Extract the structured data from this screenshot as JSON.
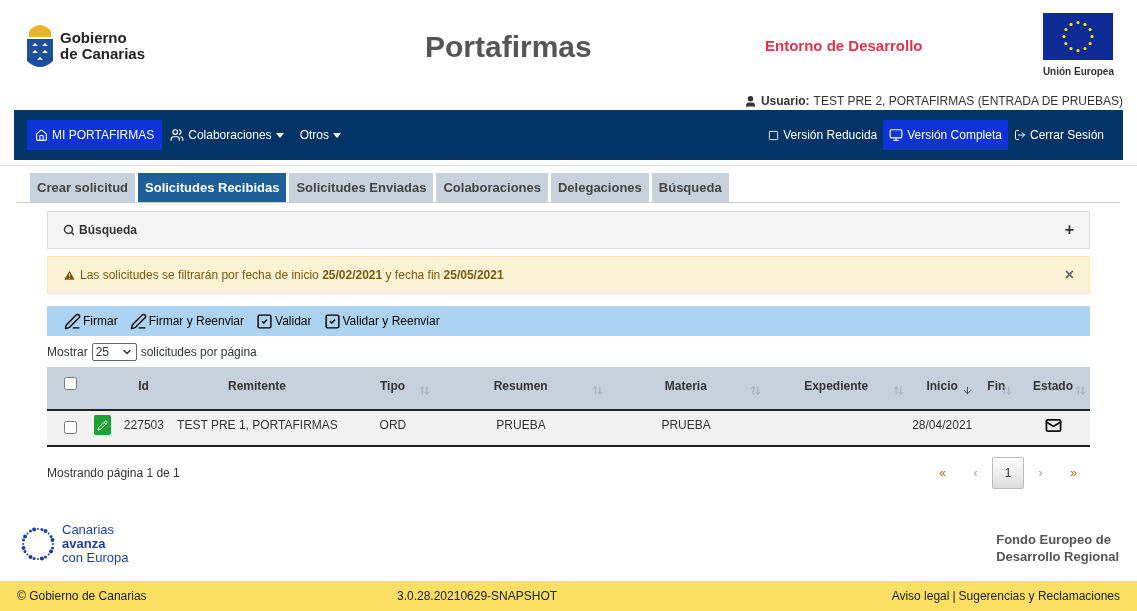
{
  "header": {
    "logo_lines": [
      "Gobierno",
      "de Canarias"
    ],
    "title": "Portafirmas",
    "environment": "Entorno de Desarrollo",
    "eu_label": "Unión Europea",
    "user_label": "Usuario:",
    "user_name": "TEST PRE 2, PORTAFIRMAS (ENTRADA DE PRUEBAS)"
  },
  "nav": {
    "left": [
      {
        "label": "MI PORTAFIRMAS",
        "selected": true,
        "dropdown": false
      },
      {
        "label": "Colaboraciones",
        "selected": false,
        "dropdown": true
      },
      {
        "label": "Otros",
        "selected": false,
        "dropdown": true
      }
    ],
    "right": [
      {
        "label": "Versión Reducida",
        "selected": false
      },
      {
        "label": "Versión Completa",
        "selected": true
      },
      {
        "label": "Cerrar Sesión",
        "selected": false
      }
    ]
  },
  "tabs": [
    {
      "label": "Crear solicitud",
      "selected": false
    },
    {
      "label": "Solicitudes Recibidas",
      "selected": true
    },
    {
      "label": "Solicitudes Enviadas",
      "selected": false
    },
    {
      "label": "Colaboraciones",
      "selected": false
    },
    {
      "label": "Delegaciones",
      "selected": false
    },
    {
      "label": "Búsqueda",
      "selected": false
    }
  ],
  "search_panel": {
    "title": "Búsqueda",
    "toggle": "+"
  },
  "alert": {
    "text": "Las solicitudes se filtrarán por fecha de inicio **25/02/2021** y fecha fin **25/05/2021**",
    "close": "×"
  },
  "actions": [
    {
      "label": "Firmar"
    },
    {
      "label": "Firmar y Reenviar"
    },
    {
      "label": "Validar"
    },
    {
      "label": "Validar y Reenviar"
    }
  ],
  "page_size": {
    "prefix": "Mostrar",
    "value": "25",
    "suffix": "solicitudes por página"
  },
  "table": {
    "select_all_checked": false,
    "columns": [
      {
        "label": "Id"
      },
      {
        "label": "Remitente"
      },
      {
        "label": "Tipo",
        "sorted": false
      },
      {
        "label": "Resumen",
        "sorted": false
      },
      {
        "label": "Materia",
        "sorted": false
      },
      {
        "label": "Expediente",
        "sorted": false
      },
      {
        "label": "Inicio",
        "sorted": true
      },
      {
        "label": "Fin",
        "sorted": false
      },
      {
        "label": "Estado",
        "sorted": false
      }
    ],
    "rows": [
      {
        "checked": false,
        "cells": [
          "227503",
          "TEST PRE 1, PORTAFIRMAS",
          "ORD",
          "PRUEBA",
          "PRUEBA",
          "",
          "28/04/2021",
          ""
        ]
      }
    ]
  },
  "pagination": {
    "info": "Mostrando página 1 de 1",
    "first": "«",
    "prev": "‹",
    "pages": [
      {
        "label": "1",
        "selected": true
      }
    ],
    "next": "›",
    "last": "»"
  },
  "footer": {
    "canarias_lines": [
      "Canarias",
      "avanza",
      "con Europa"
    ],
    "fund_lines": [
      "Fondo Europeo de",
      "Desarrollo Regional"
    ]
  },
  "bottom_bar": {
    "copyright": "© Gobierno de Canarias",
    "version": "3.0.28.20210629-SNAPSHOT",
    "links": [
      "Aviso legal",
      "Sugerencias y Reclamaciones"
    ],
    "separator": "|"
  }
}
